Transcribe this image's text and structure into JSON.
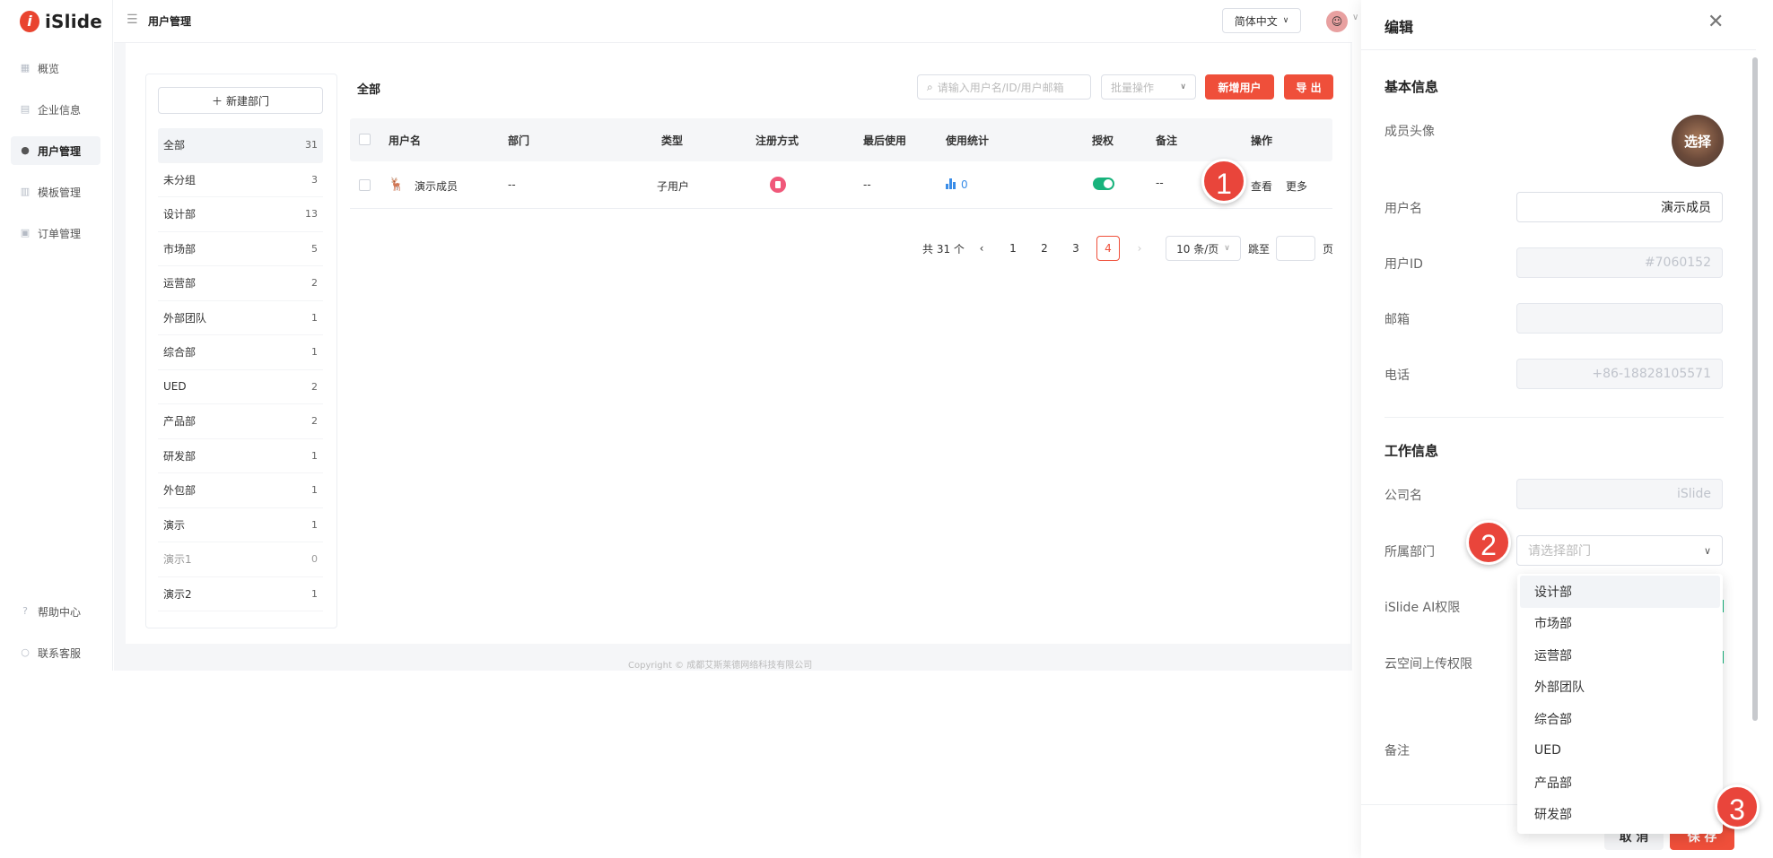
{
  "brand": {
    "name": "iSlide",
    "mark": "i"
  },
  "nav": {
    "items": [
      {
        "label": "概览",
        "icon": "dashboard-icon"
      },
      {
        "label": "企业信息",
        "icon": "company-icon"
      },
      {
        "label": "用户管理",
        "icon": "user-icon",
        "active": true
      },
      {
        "label": "模板管理",
        "icon": "chart-icon"
      },
      {
        "label": "订单管理",
        "icon": "clipboard-icon"
      }
    ],
    "bottom": [
      {
        "label": "帮助中心",
        "icon": "help-icon"
      },
      {
        "label": "联系客服",
        "icon": "chat-icon"
      }
    ]
  },
  "topbar": {
    "breadcrumb": "用户管理",
    "language": "简体中文"
  },
  "departments": {
    "new_button": "新建部门",
    "items": [
      {
        "name": "全部",
        "count": "31"
      },
      {
        "name": "未分组",
        "count": "3"
      },
      {
        "name": "设计部",
        "count": "13"
      },
      {
        "name": "市场部",
        "count": "5"
      },
      {
        "name": "运营部",
        "count": "2"
      },
      {
        "name": "外部团队",
        "count": "1"
      },
      {
        "name": "综合部",
        "count": "1"
      },
      {
        "name": "UED",
        "count": "2"
      },
      {
        "name": "产品部",
        "count": "2"
      },
      {
        "name": "研发部",
        "count": "1"
      },
      {
        "name": "外包部",
        "count": "1"
      },
      {
        "name": "演示",
        "count": "1"
      },
      {
        "name": "演示1",
        "count": "0"
      },
      {
        "name": "演示2",
        "count": "1"
      }
    ]
  },
  "table": {
    "title": "全部",
    "search_placeholder": "请输入用户名/ID/用户邮箱",
    "batch_label": "批量操作",
    "add_user": "新增用户",
    "export": "导 出",
    "columns": [
      "用户名",
      "部门",
      "类型",
      "注册方式",
      "最后使用",
      "使用统计",
      "授权",
      "备注",
      "操作"
    ],
    "rows": [
      {
        "username": "演示成员",
        "dept": "--",
        "type": "子用户",
        "last_used": "--",
        "stats": "0",
        "note": "--",
        "view": "查看",
        "more": "更多"
      }
    ]
  },
  "pagination": {
    "total": "共 31 个",
    "pages": [
      "1",
      "2",
      "3",
      "4"
    ],
    "current": "4",
    "page_size": "10 条/页",
    "jump_label": "跳至",
    "page_unit": "页"
  },
  "copyright": "Copyright © 成都艾斯莱德网络科技有限公司",
  "drawer": {
    "title": "编辑",
    "basic_title": "基本信息",
    "avatar_label": "成员头像",
    "avatar_action": "选择",
    "username_label": "用户名",
    "username_value": "演示成员",
    "userid_label": "用户ID",
    "userid_value": "#7060152",
    "email_label": "邮箱",
    "email_value": "",
    "phone_label": "电话",
    "phone_value": "+86-18828105571",
    "work_title": "工作信息",
    "company_label": "公司名",
    "company_value": "iSlide",
    "dept_label": "所属部门",
    "dept_placeholder": "请选择部门",
    "ai_label": "iSlide AI权限",
    "cloud_label": "云空间上传权限",
    "note_label": "备注",
    "cancel": "取 消",
    "save": "保 存"
  },
  "dropdown": {
    "options": [
      "设计部",
      "市场部",
      "运营部",
      "外部团队",
      "综合部",
      "UED",
      "产品部",
      "研发部"
    ]
  },
  "steps": [
    "1",
    "2",
    "3"
  ],
  "colors": {
    "accent": "#ef4f3a",
    "toggle_on": "#18b37c",
    "stat_bar": "#3a8de8",
    "reg_icon": "#f0587a",
    "step_marker": "#e9453b"
  }
}
